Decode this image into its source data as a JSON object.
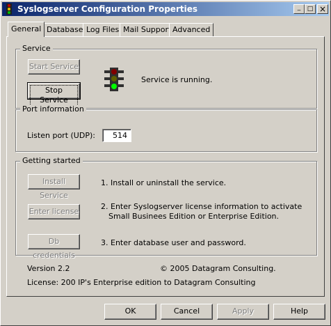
{
  "window": {
    "title": "Syslogserver Configuration Properties",
    "minimize_glyph": "_",
    "maximize_glyph": "□",
    "close_glyph": "×"
  },
  "tabs": [
    {
      "label": "General",
      "active": true
    },
    {
      "label": "Database",
      "active": false
    },
    {
      "label": "Log Files",
      "active": false
    },
    {
      "label": "Mail Support",
      "active": false
    },
    {
      "label": "Advanced",
      "active": false
    }
  ],
  "service": {
    "group_label": "Service",
    "start_button": "Start Service",
    "stop_button": "Stop Service",
    "status_text": "Service is running.",
    "status_icon": "traffic-light-green-icon"
  },
  "port": {
    "group_label": "Port information",
    "listen_label": "Listen port (UDP):",
    "listen_value": "514"
  },
  "getting_started": {
    "group_label": "Getting started",
    "install_button": "Install Service",
    "install_text": "1. Install or uninstall the service.",
    "license_button": "Enter license",
    "license_text_1": "2. Enter Syslogserver license information to activate",
    "license_text_2": "Small Businees Edition or Enterprise Edition.",
    "db_button": "Db credentials",
    "db_text": "3. Enter database user and password."
  },
  "info": {
    "version": "Version 2.2",
    "copyright": "© 2005 Datagram Consulting.",
    "license": "License: 200 IP's Enterprise edition to Datagram Consulting"
  },
  "dialog_buttons": {
    "ok": "OK",
    "cancel": "Cancel",
    "apply": "Apply",
    "help": "Help"
  },
  "colors": {
    "titlebar_start": "#0a246a",
    "titlebar_end": "#a6caf0",
    "face": "#d4d0c8",
    "light_red": "#800000",
    "light_green": "#00ff00"
  }
}
